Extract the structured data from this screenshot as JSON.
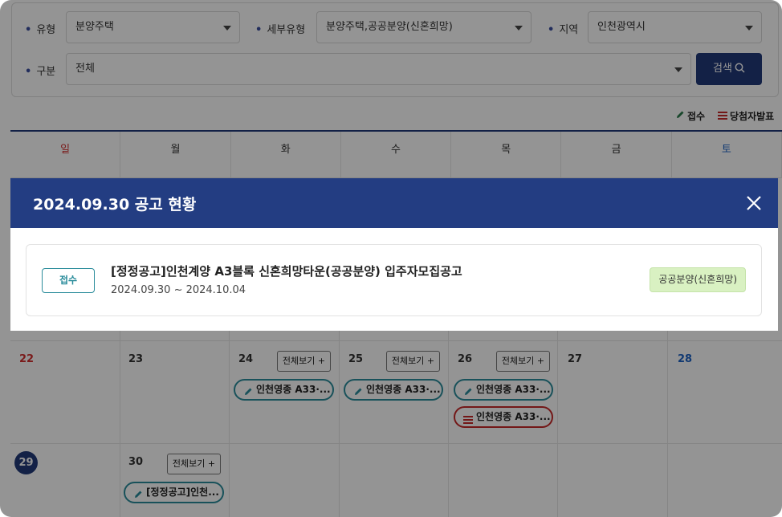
{
  "filters": {
    "type": {
      "label": "유형",
      "value": "분양주택"
    },
    "subtype": {
      "label": "세부유형",
      "value": "분양주택,공공분양(신혼희망)"
    },
    "region": {
      "label": "지역",
      "value": "인천광역시"
    },
    "category": {
      "label": "구분",
      "value": "전체"
    },
    "search_label": "검색"
  },
  "legend": {
    "receipt": "접수",
    "winner": "당첨자발표"
  },
  "weekdays": [
    "일",
    "월",
    "화",
    "수",
    "목",
    "금",
    "토"
  ],
  "calendar": {
    "row1": {
      "sun": "22",
      "mon": "23",
      "tue": "24",
      "wed": "25",
      "thu": "26",
      "fri": "27",
      "sat": "28"
    },
    "row2": {
      "sun": "29",
      "mon": "30"
    },
    "view_all": "전체보기 +",
    "events": {
      "tue_receipt": "인천영종 A33·...",
      "wed_receipt": "인천영종 A33·...",
      "thu_receipt": "인천영종 A33·...",
      "thu_winner": "인천영종 A33·...",
      "mon30_receipt": "[정정공고]인천..."
    }
  },
  "modal": {
    "title": "2024.09.30 공고 현황",
    "notice": {
      "status": "접수",
      "title": "[정정공고]인천계양 A3블록 신혼희망타운(공공분양) 입주자모집공고",
      "period": "2024.09.30 ~ 2024.10.04",
      "type": "공공분양(신혼희망)"
    }
  },
  "colors": {
    "primary": "#213a79",
    "teal": "#2a8c9b",
    "red": "#c62828",
    "badge_green": "#d9f1c2"
  }
}
